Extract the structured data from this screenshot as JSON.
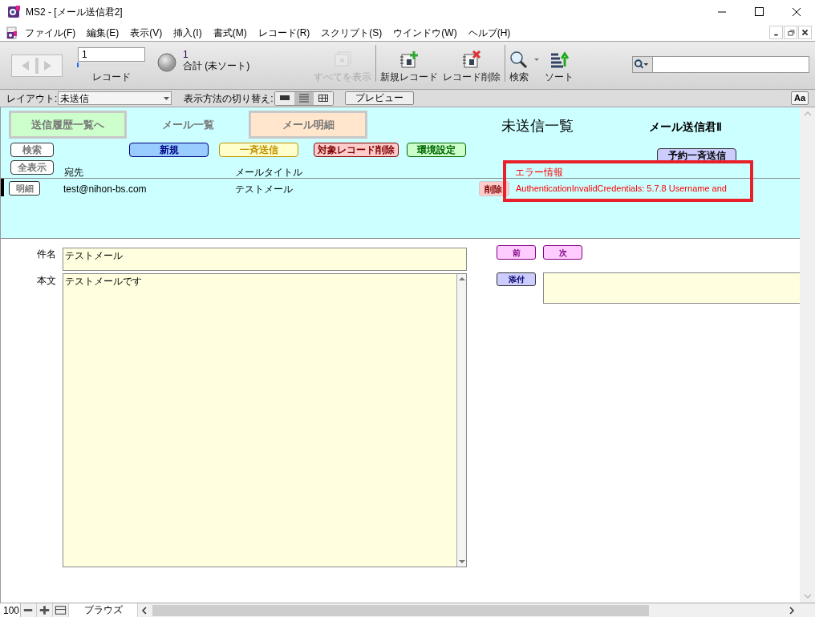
{
  "window": {
    "title": "MS2 - [メール送信君2]"
  },
  "menu": [
    "ファイル(F)",
    "編集(E)",
    "表示(V)",
    "挿入(I)",
    "書式(M)",
    "レコード(R)",
    "スクリプト(S)",
    "ウインドウ(W)",
    "ヘルプ(H)"
  ],
  "toolbar": {
    "record_number": "1",
    "record_label": "レコード",
    "level": 0,
    "found": "1",
    "total": "合計 (未ソート)",
    "buttons": [
      {
        "kind": "showall",
        "label": "すべてを表示",
        "disabled": true
      },
      {
        "kind": "newrec",
        "label": "新規レコード",
        "disabled": false
      },
      {
        "kind": "delrec",
        "label": "レコード削除",
        "disabled": false
      },
      {
        "kind": "find",
        "label": "検索",
        "disabled": false
      },
      {
        "kind": "sort",
        "label": "ソート",
        "disabled": false
      }
    ]
  },
  "layout_bar": {
    "layout_label": "レイアウト:",
    "layout_value": "未送信",
    "view_label": "表示方法の切り替え:",
    "views": [
      {
        "kind": "form",
        "selected": false
      },
      {
        "kind": "list",
        "selected": true
      },
      {
        "kind": "table",
        "selected": false
      }
    ],
    "preview": "プレビュー",
    "text_size": "Aa"
  },
  "tabs": [
    {
      "label": "送信履歴一覧へ",
      "color": "#ccffcc",
      "selected": false
    },
    {
      "label": "メール一覧",
      "color": "#ccffff",
      "selected": true
    },
    {
      "label": "メール明細",
      "color": "#ffe6cc",
      "selected": false
    }
  ],
  "title": "未送信一覧",
  "app_name": "メール送信君Ⅱ",
  "buttons": [
    {
      "label": "検索",
      "color": "#ffffff"
    },
    {
      "label": "新規",
      "color": "#99ccff"
    },
    {
      "label": "一斉送信",
      "color": "#ffffcc"
    },
    {
      "label": "対象レコード削除",
      "color": "#ffcccc"
    },
    {
      "label": "環境設定",
      "color": "#ccffcc"
    },
    {
      "label": "予約一斉送信",
      "color": "#ccccff"
    },
    {
      "label": "全表示",
      "color": "#ffffff"
    }
  ],
  "columns": [
    "宛先",
    "メールタイトル",
    "エラー情報"
  ],
  "rows": [
    {
      "current": true,
      "detail": "明細",
      "to": "test@nihon-bs.com",
      "subject": "テストメール",
      "delete": "削除",
      "error": "AuthenticationInvalidCredentials: 5.7.8 Username and"
    }
  ],
  "form": {
    "subject_label": "件名",
    "subject": "テストメール",
    "body_label": "本文",
    "body": "テストメールです",
    "prev": "前",
    "next": "次",
    "attach": "添付"
  },
  "status": {
    "zoom": "100",
    "mode": "ブラウズ"
  }
}
